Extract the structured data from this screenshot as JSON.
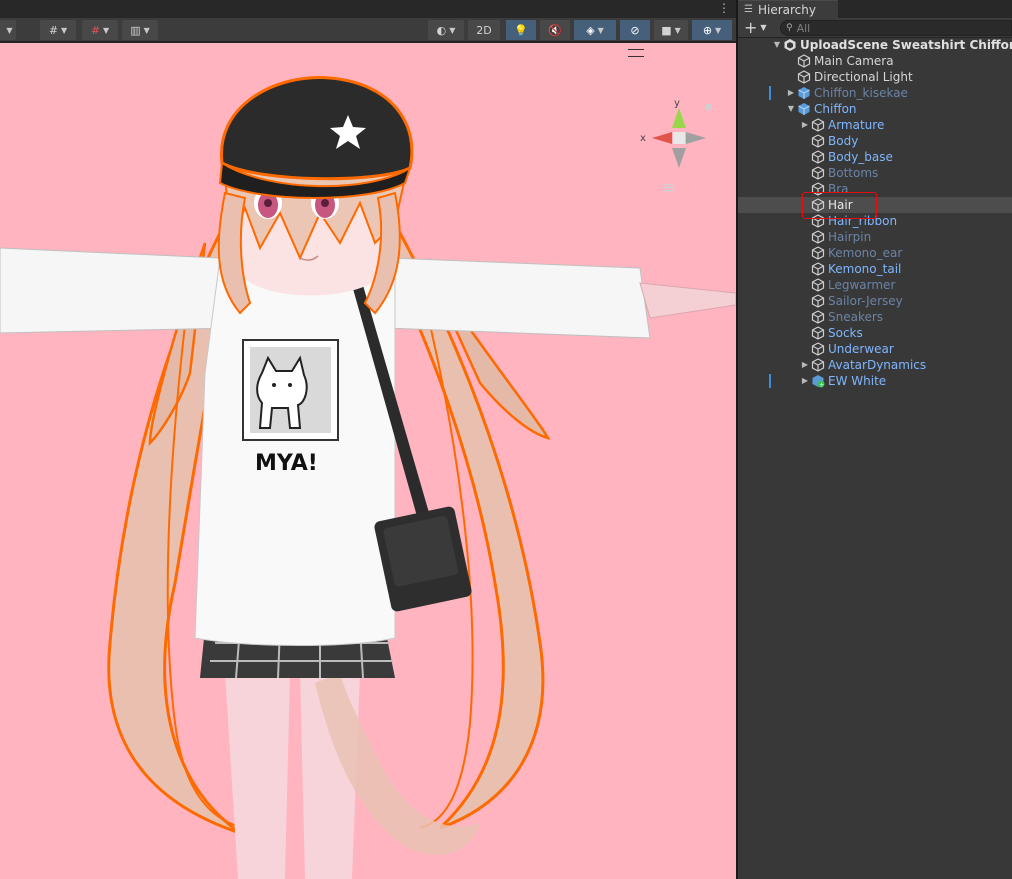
{
  "scene": {
    "toolbar": {
      "mode_2d_label": "2D"
    },
    "viewport": {
      "background": "#ffb4bf",
      "shirt_text": "MYA!",
      "gizmo": {
        "y_label": "y",
        "x_label": "x"
      }
    }
  },
  "hierarchy": {
    "tab_label": "Hierarchy",
    "search_placeholder": "All",
    "rows": [
      {
        "label": "UploadScene Sweatshirt Chiffon*",
        "style": "bold",
        "depth": 0,
        "arrow": "down",
        "icon": "unity-scene-icon"
      },
      {
        "label": "Main Camera",
        "style": "white",
        "depth": 1,
        "arrow": "",
        "icon": "gameobject-icon"
      },
      {
        "label": "Directional Light",
        "style": "white",
        "depth": 1,
        "arrow": "",
        "icon": "gameobject-icon"
      },
      {
        "label": "Chiffon_kisekae",
        "style": "dim",
        "depth": 1,
        "arrow": "right",
        "icon": "prefab-icon",
        "mark": true
      },
      {
        "label": "Chiffon",
        "style": "blue",
        "depth": 1,
        "arrow": "down",
        "icon": "prefab-icon"
      },
      {
        "label": "Armature",
        "style": "blue",
        "depth": 2,
        "arrow": "right",
        "icon": "gameobject-icon"
      },
      {
        "label": "Body",
        "style": "blue",
        "depth": 2,
        "arrow": "",
        "icon": "gameobject-icon"
      },
      {
        "label": "Body_base",
        "style": "blue",
        "depth": 2,
        "arrow": "",
        "icon": "gameobject-icon"
      },
      {
        "label": "Bottoms",
        "style": "dim",
        "depth": 2,
        "arrow": "",
        "icon": "gameobject-icon"
      },
      {
        "label": "Bra",
        "style": "dim",
        "depth": 2,
        "arrow": "",
        "icon": "gameobject-icon"
      },
      {
        "label": "Hair",
        "style": "sel",
        "depth": 2,
        "arrow": "",
        "icon": "gameobject-icon",
        "selected": true
      },
      {
        "label": "Hair_ribbon",
        "style": "blue",
        "depth": 2,
        "arrow": "",
        "icon": "gameobject-icon"
      },
      {
        "label": "Hairpin",
        "style": "dim",
        "depth": 2,
        "arrow": "",
        "icon": "gameobject-icon"
      },
      {
        "label": "Kemono_ear",
        "style": "dim",
        "depth": 2,
        "arrow": "",
        "icon": "gameobject-icon"
      },
      {
        "label": "Kemono_tail",
        "style": "blue",
        "depth": 2,
        "arrow": "",
        "icon": "gameobject-icon"
      },
      {
        "label": "Legwarmer",
        "style": "dim",
        "depth": 2,
        "arrow": "",
        "icon": "gameobject-icon"
      },
      {
        "label": "Sailor-Jersey",
        "style": "dim",
        "depth": 2,
        "arrow": "",
        "icon": "gameobject-icon"
      },
      {
        "label": "Sneakers",
        "style": "dim",
        "depth": 2,
        "arrow": "",
        "icon": "gameobject-icon"
      },
      {
        "label": "Socks",
        "style": "blue",
        "depth": 2,
        "arrow": "",
        "icon": "gameobject-icon"
      },
      {
        "label": "Underwear",
        "style": "blue",
        "depth": 2,
        "arrow": "",
        "icon": "gameobject-icon"
      },
      {
        "label": "AvatarDynamics",
        "style": "blue",
        "depth": 2,
        "arrow": "right",
        "icon": "gameobject-icon"
      },
      {
        "label": "EW White",
        "style": "blue",
        "depth": 2,
        "arrow": "right",
        "icon": "prefab-variant-icon",
        "mark": true
      }
    ]
  }
}
